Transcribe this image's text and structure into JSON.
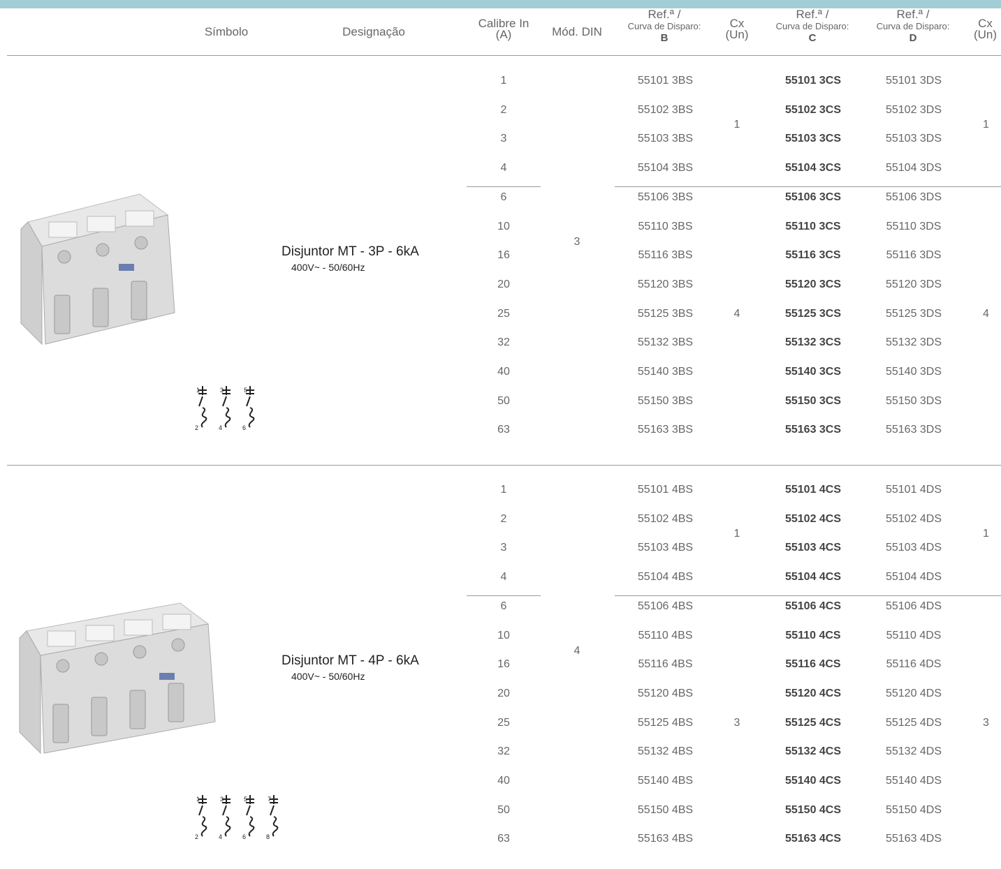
{
  "colors": {
    "topbar": "#a3cdd4",
    "rule": "#9a9a9a"
  },
  "header": {
    "simbolo": "Símbolo",
    "designacao": "Designação",
    "calibre_line1": "Calibre In",
    "calibre_line2": "(A)",
    "mod_din": "Mód. DIN",
    "ref_b_line1": "Ref.ª /",
    "ref_b_line2": "Curva de Disparo:",
    "ref_b_letter": "B",
    "cx1_line1": "Cx",
    "cx1_line2": "(Un)",
    "ref_c_line1": "Ref.ª /",
    "ref_c_line2": "Curva de Disparo:",
    "ref_c_letter": "C",
    "ref_d_line1": "Ref.ª /",
    "ref_d_line2": "Curva de Disparo:",
    "ref_d_letter": "D",
    "cx2_line1": "Cx",
    "cx2_line2": "(Un)"
  },
  "groups": [
    {
      "designation": "Disjuntor MT - 3P - 6kA",
      "voltage": "400V~ - 50/60Hz",
      "mod_din": "3",
      "icon": "breaker-3p-image",
      "symbol_icon": "breaker-3p-symbol",
      "cx_small_b": "1",
      "cx_small_d": "1",
      "cx_large_b": "4",
      "cx_large_d": "4",
      "rows": [
        {
          "calibre": "1",
          "b": "55101 3BS",
          "c": "55101 3CS",
          "d": "55101 3DS"
        },
        {
          "calibre": "2",
          "b": "55102 3BS",
          "c": "55102 3CS",
          "d": "55102 3DS"
        },
        {
          "calibre": "3",
          "b": "55103 3BS",
          "c": "55103 3CS",
          "d": "55103 3DS"
        },
        {
          "calibre": "4",
          "b": "55104 3BS",
          "c": "55104 3CS",
          "d": "55104 3DS"
        },
        {
          "calibre": "6",
          "b": "55106 3BS",
          "c": "55106 3CS",
          "d": "55106 3DS"
        },
        {
          "calibre": "10",
          "b": "55110 3BS",
          "c": "55110 3CS",
          "d": "55110 3DS"
        },
        {
          "calibre": "16",
          "b": "55116 3BS",
          "c": "55116 3CS",
          "d": "55116 3DS"
        },
        {
          "calibre": "20",
          "b": "55120 3BS",
          "c": "55120 3CS",
          "d": "55120 3DS"
        },
        {
          "calibre": "25",
          "b": "55125 3BS",
          "c": "55125 3CS",
          "d": "55125 3DS"
        },
        {
          "calibre": "32",
          "b": "55132 3BS",
          "c": "55132 3CS",
          "d": "55132 3DS"
        },
        {
          "calibre": "40",
          "b": "55140 3BS",
          "c": "55140 3CS",
          "d": "55140 3DS"
        },
        {
          "calibre": "50",
          "b": "55150 3BS",
          "c": "55150 3CS",
          "d": "55150 3DS"
        },
        {
          "calibre": "63",
          "b": "55163 3BS",
          "c": "55163 3CS",
          "d": "55163 3DS"
        }
      ]
    },
    {
      "designation": "Disjuntor MT - 4P - 6kA",
      "voltage": "400V~ - 50/60Hz",
      "mod_din": "4",
      "icon": "breaker-4p-image",
      "symbol_icon": "breaker-4p-symbol",
      "cx_small_b": "1",
      "cx_small_d": "1",
      "cx_large_b": "3",
      "cx_large_d": "3",
      "rows": [
        {
          "calibre": "1",
          "b": "55101 4BS",
          "c": "55101 4CS",
          "d": "55101 4DS"
        },
        {
          "calibre": "2",
          "b": "55102 4BS",
          "c": "55102 4CS",
          "d": "55102 4DS"
        },
        {
          "calibre": "3",
          "b": "55103 4BS",
          "c": "55103 4CS",
          "d": "55103 4DS"
        },
        {
          "calibre": "4",
          "b": "55104 4BS",
          "c": "55104 4CS",
          "d": "55104 4DS"
        },
        {
          "calibre": "6",
          "b": "55106 4BS",
          "c": "55106 4CS",
          "d": "55106 4DS"
        },
        {
          "calibre": "10",
          "b": "55110 4BS",
          "c": "55110 4CS",
          "d": "55110 4DS"
        },
        {
          "calibre": "16",
          "b": "55116 4BS",
          "c": "55116 4CS",
          "d": "55116 4DS"
        },
        {
          "calibre": "20",
          "b": "55120 4BS",
          "c": "55120 4CS",
          "d": "55120 4DS"
        },
        {
          "calibre": "25",
          "b": "55125 4BS",
          "c": "55125 4CS",
          "d": "55125 4DS"
        },
        {
          "calibre": "32",
          "b": "55132 4BS",
          "c": "55132 4CS",
          "d": "55132 4DS"
        },
        {
          "calibre": "40",
          "b": "55140 4BS",
          "c": "55140 4CS",
          "d": "55140 4DS"
        },
        {
          "calibre": "50",
          "b": "55150 4BS",
          "c": "55150 4CS",
          "d": "55150 4DS"
        },
        {
          "calibre": "63",
          "b": "55163 4BS",
          "c": "55163 4CS",
          "d": "55163 4DS"
        }
      ]
    }
  ]
}
